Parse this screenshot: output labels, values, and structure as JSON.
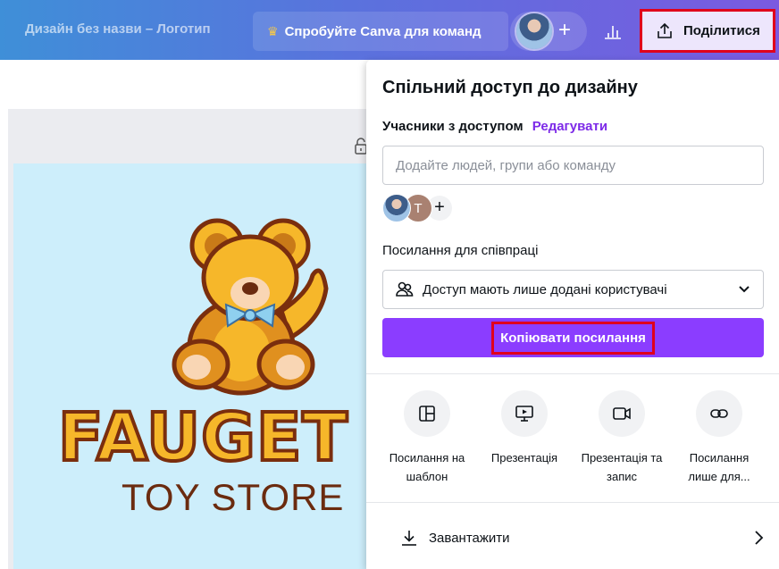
{
  "topbar": {
    "doc_title": "Дизайн без назви – Логотип",
    "try_label": "Спробуйте Canva для команд",
    "share_label": "Поділитися"
  },
  "design": {
    "brand_word": "FAUGET",
    "brand_sub": "TOY STORE"
  },
  "share_panel": {
    "title": "Спільний доступ до дизайну",
    "members_label": "Учасники з доступом",
    "edit_link": "Редагувати",
    "people_placeholder": "Додайте людей, групи або команду",
    "member_initial": "T",
    "add_member": "+",
    "collab_label": "Посилання для співпраці",
    "access_value": "Доступ мають лише додані користувачі",
    "copy_label": "Копіювати посилання",
    "options": [
      {
        "line1": "Посилання на",
        "line2": "шаблон",
        "icon": "template-icon"
      },
      {
        "line1": "Презентація",
        "line2": "",
        "icon": "presentation-icon"
      },
      {
        "line1": "Презентація та",
        "line2": "запис",
        "icon": "record-icon"
      },
      {
        "line1": "Посилання",
        "line2": "лише для...",
        "icon": "link-icon"
      }
    ],
    "download_label": "Завантажити"
  },
  "colors": {
    "accent": "#8b3dff",
    "highlight": "#e0001b",
    "link": "#7d2ae8"
  }
}
